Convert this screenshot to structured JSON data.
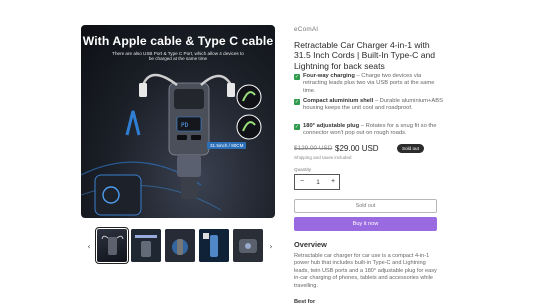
{
  "gallery": {
    "hero_title": "With Apple cable & Type C cable",
    "hero_subtitle": "There are also USB Port & Type C Port, which allow 4 devices to be charged at the same time",
    "spec_tag": "31.5inch / 80CM",
    "prev_arrow": "‹",
    "next_arrow": "›"
  },
  "product": {
    "vendor": "eComAI",
    "title": "Retractable Car Charger 4-in-1 with 31.5 Inch Cords | Built-In Type-C and Lightning for back seats",
    "features": [
      {
        "heading": "Four-way charging",
        "text": " – Charge two devices via retracting leads plus two via USB ports at the same time."
      },
      {
        "heading": "Compact aluminium shell",
        "text": " – Durable aluminium+ABS housing keeps the unit cool and roadproof."
      },
      {
        "heading": "180° adjustable plug",
        "text": " – Rotates for a snug fit so the connector won't pop out on rough roads."
      }
    ],
    "check_glyph": "✓",
    "price_old": "$129.00 USD",
    "price_new": "$29.00 USD",
    "badge": "Sold out",
    "tax_note": "Shipping and taxes included",
    "quantity_label": "Quantity",
    "quantity_value": "1",
    "minus": "−",
    "plus": "+",
    "sold_out_button": "Sold out",
    "buy_now_button": "Buy it now",
    "overview_heading": "Overview",
    "overview_text": "Retractable car charger for car use is a compact 4-in-1 power hub that includes built-in Type-C and Lightning leads, twin USB ports and a 180° adjustable plug for easy in-car charging of phones, tablets and accessories while travelling.",
    "best_for_heading": "Best for"
  }
}
